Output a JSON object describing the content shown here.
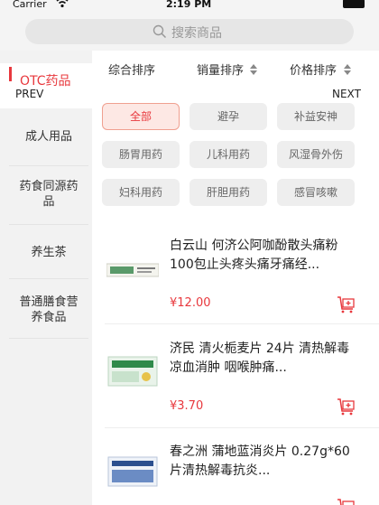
{
  "status_bar": {
    "carrier": "Carrier",
    "time": "2:19 PM",
    "wifi_icon": "wifi-icon",
    "battery_icon": "battery-icon"
  },
  "search": {
    "placeholder": "搜索商品",
    "icon": "search-icon"
  },
  "sidebar": {
    "items": [
      {
        "label": "OTC药品",
        "active": true
      },
      {
        "label": "成人用品",
        "active": false
      },
      {
        "label": "药食同源药品",
        "active": false
      },
      {
        "label": "养生茶",
        "active": false
      },
      {
        "label": "普通膳食营养食品",
        "active": false
      }
    ]
  },
  "sort_bar": {
    "items": [
      "综合排序",
      "销量排序",
      "价格排序"
    ]
  },
  "nav": {
    "prev": "PREV",
    "next": "NEXT"
  },
  "filters": {
    "chips": [
      "全部",
      "避孕",
      "补益安神",
      "肠胃用药",
      "儿科用药",
      "风湿骨外伤",
      "妇科用药",
      "肝胆用药",
      "感冒咳嗽"
    ],
    "selected": "全部"
  },
  "products": [
    {
      "title": "白云山 何济公阿咖酚散头痛粉100包止头疼头痛牙痛经...",
      "price": "¥12.00"
    },
    {
      "title": "济民 清火栀麦片 24片 清热解毒 凉血消肿 咽喉肿痛...",
      "price": "¥3.70"
    },
    {
      "title": "春之洲 蒲地蓝消炎片 0.27g*60片清热解毒抗炎...",
      "price": ""
    }
  ],
  "colors": {
    "accent": "#e8383d",
    "sidebar_bg": "#f2f2f2",
    "chip_bg": "#eeeeee"
  }
}
